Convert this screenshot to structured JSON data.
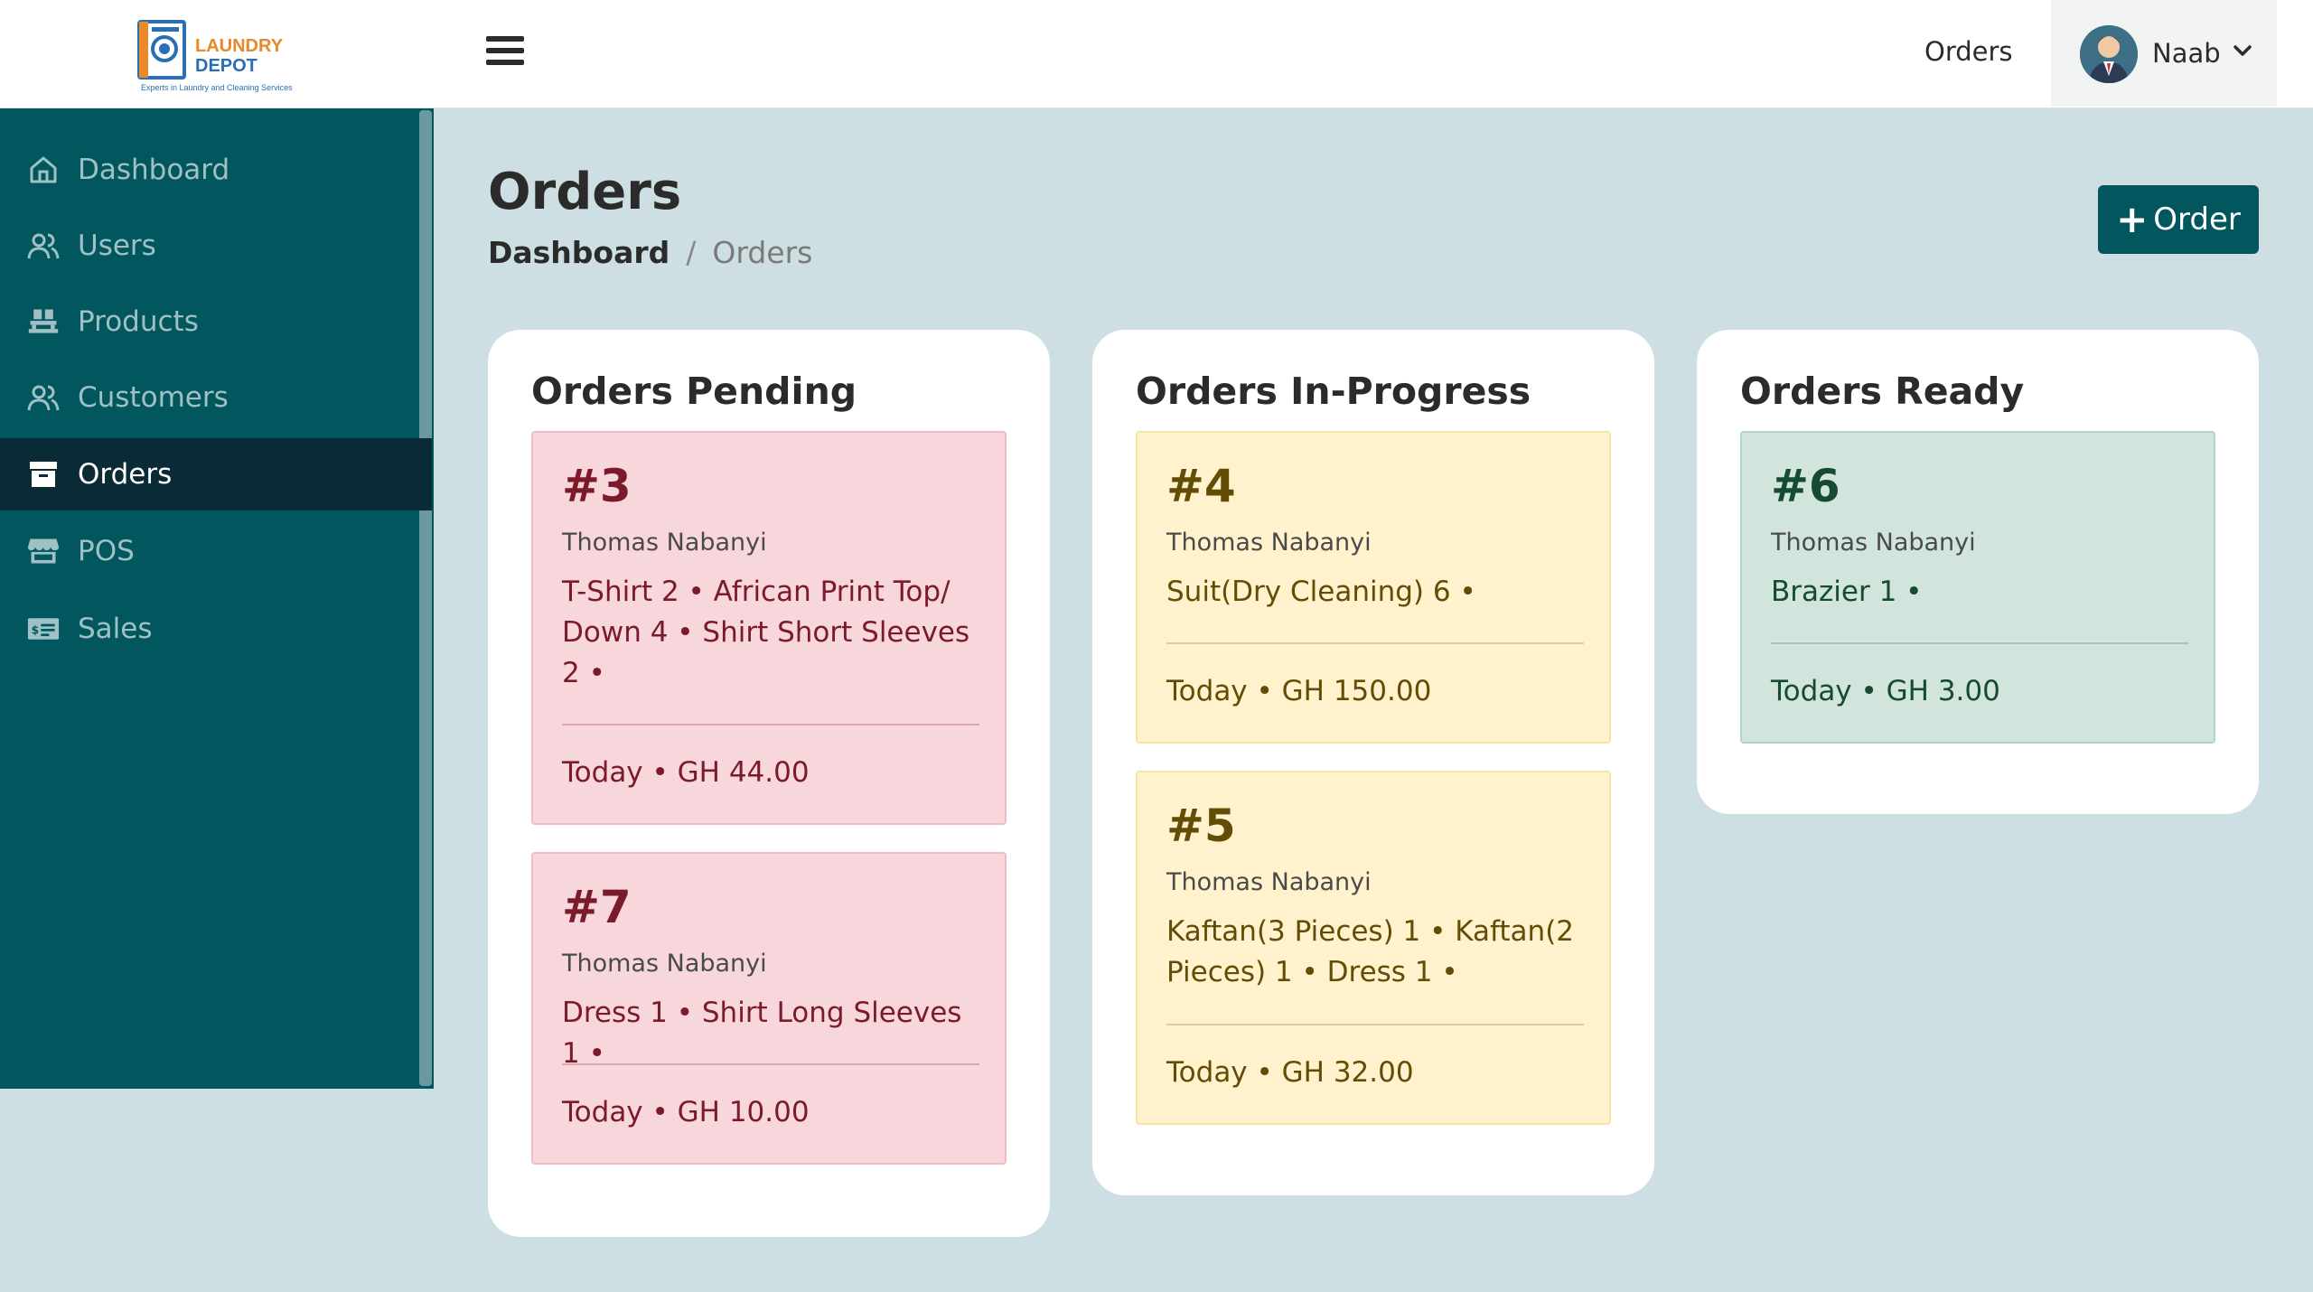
{
  "header": {
    "logo": {
      "line1": "LAUNDRY",
      "line2": "DEPOT",
      "tagline": "Experts in Laundry and Cleaning Services"
    },
    "menu_icon": "hamburger-icon",
    "orders_link": "Orders",
    "user": {
      "name": "Naab",
      "avatar_icon": "avatar-icon",
      "dropdown_icon": "chevron-down-icon"
    }
  },
  "sidebar": {
    "items": [
      {
        "label": "Dashboard",
        "icon": "home-icon",
        "active": false
      },
      {
        "label": "Users",
        "icon": "users-icon",
        "active": false
      },
      {
        "label": "Products",
        "icon": "pallet-icon",
        "active": false
      },
      {
        "label": "Customers",
        "icon": "users-icon",
        "active": false
      },
      {
        "label": "Orders",
        "icon": "archive-box-icon",
        "active": true
      },
      {
        "label": "POS",
        "icon": "store-icon",
        "active": false
      },
      {
        "label": "Sales",
        "icon": "money-bill-icon",
        "active": false
      }
    ]
  },
  "page": {
    "title": "Orders",
    "breadcrumb": {
      "link": "Dashboard",
      "separator": "/",
      "current": "Orders"
    },
    "add_button": {
      "icon": "plus-icon",
      "label": "Order"
    }
  },
  "columns": [
    {
      "title": "Orders Pending",
      "orders": [
        {
          "number": "#3",
          "customer": "Thomas Nabanyi",
          "items": "T-Shirt 2 • African Print Top/ Down 4 • Shirt Short Sleeves 2 •",
          "footer": "Today • GH 44.00"
        },
        {
          "number": "#7",
          "customer": "Thomas Nabanyi",
          "items": "Dress 1 • Shirt Long Sleeves 1 •",
          "footer": "Today • GH 10.00"
        }
      ]
    },
    {
      "title": "Orders In-Progress",
      "orders": [
        {
          "number": "#4",
          "customer": "Thomas Nabanyi",
          "items": "Suit(Dry Cleaning) 6 •",
          "footer": "Today • GH 150.00"
        },
        {
          "number": "#5",
          "customer": "Thomas Nabanyi",
          "items": "Kaftan(3 Pieces) 1 • Kaftan(2 Pieces) 1 • Dress 1 •",
          "footer": "Today • GH 32.00"
        }
      ]
    },
    {
      "title": "Orders Ready",
      "orders": [
        {
          "number": "#6",
          "customer": "Thomas Nabanyi",
          "items": "Brazier 1 •",
          "footer": "Today • GH 3.00"
        }
      ]
    }
  ],
  "colors": {
    "primary": "#02575f",
    "sidebar_active": "#0a2a35",
    "pending_bg": "#f7d7dc",
    "progress_bg": "#fff2cc",
    "ready_bg": "#d2e5dc",
    "page_bg": "#cddfe2"
  }
}
